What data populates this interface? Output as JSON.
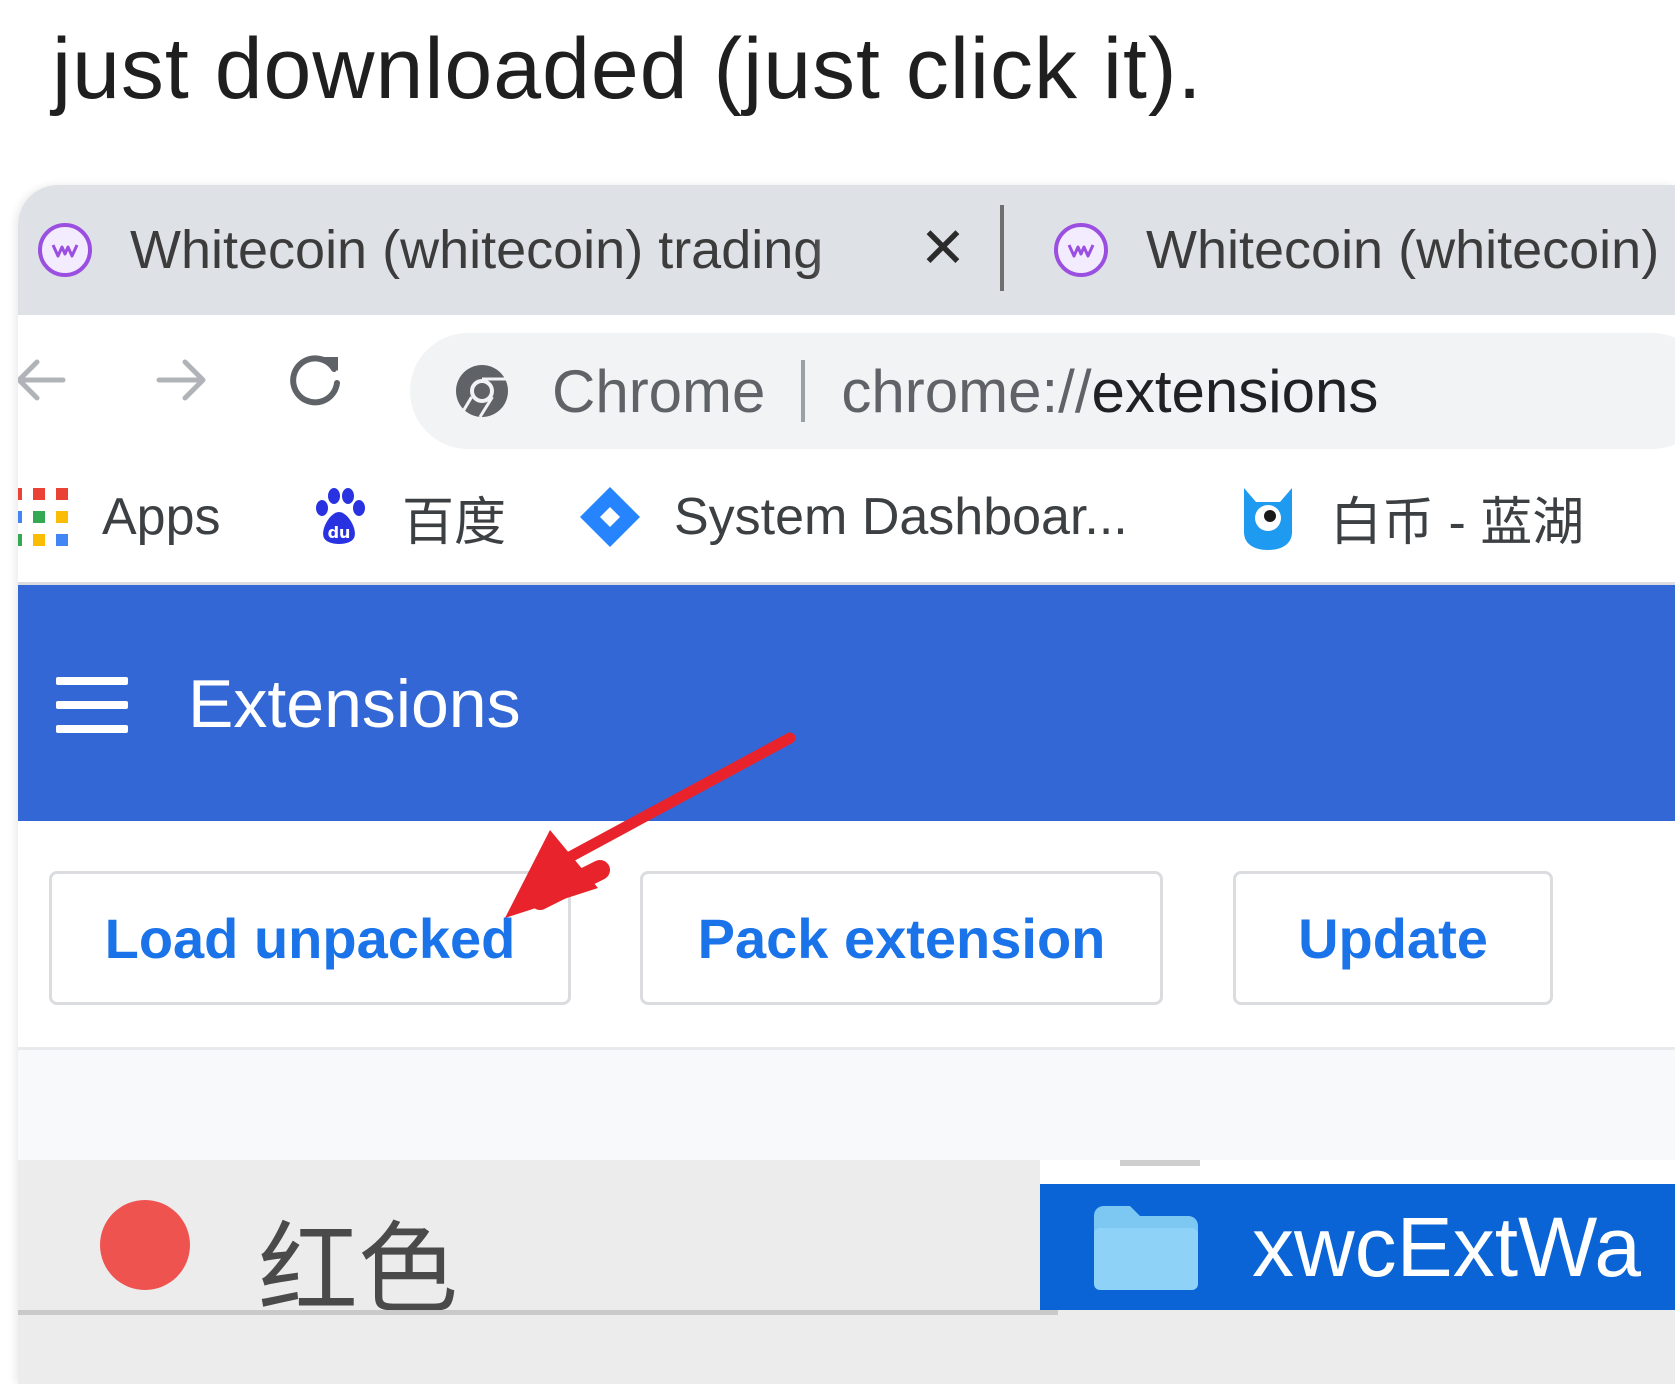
{
  "caption": "just downloaded (just click it).",
  "tabs": [
    {
      "title": "Whitecoin (whitecoin) trading",
      "favicon": "whitecoin-icon"
    },
    {
      "title": "Whitecoin (whitecoin)",
      "favicon": "whitecoin-icon"
    }
  ],
  "tab_close_glyph": "✕",
  "omnibox": {
    "site_label": "Chrome",
    "url_scheme": "chrome://",
    "url_path": "extensions"
  },
  "bookmarks": [
    {
      "label": "Apps",
      "icon": "apps-grid-icon"
    },
    {
      "label": "百度",
      "icon": "baidu-paw-icon"
    },
    {
      "label": "System Dashboar...",
      "icon": "jira-diamond-icon"
    },
    {
      "label": "白币 - 蓝湖",
      "icon": "lanhu-mascot-icon"
    }
  ],
  "extensions": {
    "title": "Extensions",
    "buttons": {
      "load_unpacked": "Load unpacked",
      "pack_extension": "Pack extension",
      "update": "Update"
    }
  },
  "finder": {
    "tag_label": "红色",
    "selected_folder": "xwcExtWa"
  },
  "colors": {
    "header_blue": "#3367d6",
    "button_text_blue": "#1a73e8",
    "finder_selection_blue": "#0a64d6",
    "red_tag": "#ef5350",
    "annotation_arrow": "#e8232b",
    "favicon_purple": "#9b4fe0"
  }
}
